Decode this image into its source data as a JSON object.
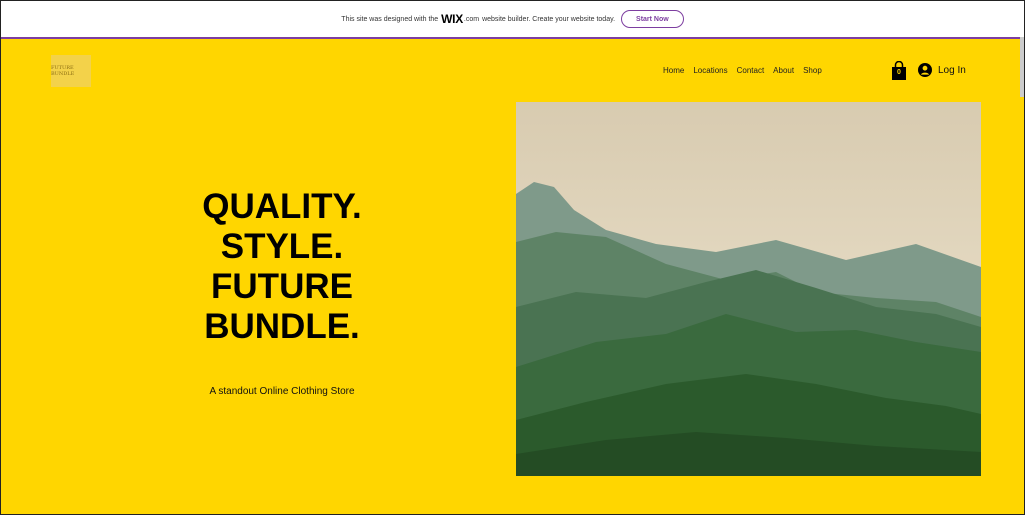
{
  "banner": {
    "text_before": "This site was designed with the",
    "wix_logo": "WIX",
    "wix_suffix": ".com",
    "text_after": "website builder. Create your website today.",
    "cta_label": "Start Now",
    "accent_color": "#7d3ea0"
  },
  "site": {
    "logo_text": "FUTURE BUNDLE",
    "background_color": "#ffd600"
  },
  "nav": {
    "items": [
      {
        "label": "Home"
      },
      {
        "label": "Locations"
      },
      {
        "label": "Contact"
      },
      {
        "label": "About"
      },
      {
        "label": "Shop"
      }
    ]
  },
  "header": {
    "cart_icon": "shopping-bag-icon",
    "cart_count": "0",
    "login_icon": "user-avatar-icon",
    "login_label": "Log In"
  },
  "hero": {
    "headline_lines": [
      "QUALITY.",
      "STYLE.",
      "FUTURE",
      "BUNDLE."
    ],
    "subtitle": "A standout Online Clothing Store",
    "image_subject": "misty-green-mountains"
  }
}
